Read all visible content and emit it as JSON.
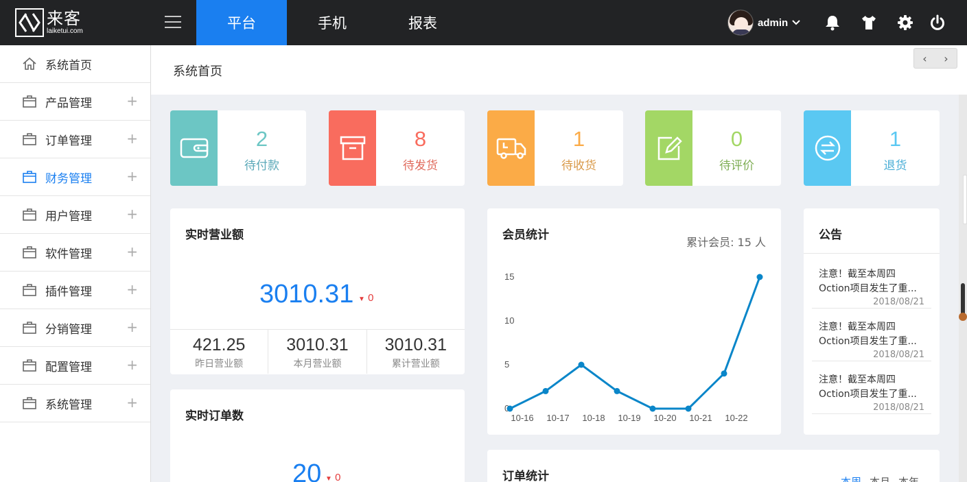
{
  "brand": {
    "name": "来客",
    "domain": "laiketui.com"
  },
  "nav": [
    {
      "label": "平台",
      "active": true
    },
    {
      "label": "手机",
      "active": false
    },
    {
      "label": "报表",
      "active": false
    }
  ],
  "user": {
    "name": "admin"
  },
  "sidebar": {
    "items": [
      {
        "label": "系统首页",
        "icon": "home-icon",
        "expandable": false,
        "active": false
      },
      {
        "label": "产品管理",
        "icon": "briefcase-icon",
        "expandable": true,
        "active": false
      },
      {
        "label": "订单管理",
        "icon": "briefcase-icon",
        "expandable": true,
        "active": false
      },
      {
        "label": "财务管理",
        "icon": "briefcase-icon",
        "expandable": true,
        "active": true
      },
      {
        "label": "用户管理",
        "icon": "briefcase-icon",
        "expandable": true,
        "active": false
      },
      {
        "label": "软件管理",
        "icon": "briefcase-icon",
        "expandable": true,
        "active": false
      },
      {
        "label": "插件管理",
        "icon": "briefcase-icon",
        "expandable": true,
        "active": false
      },
      {
        "label": "分销管理",
        "icon": "briefcase-icon",
        "expandable": true,
        "active": false
      },
      {
        "label": "配置管理",
        "icon": "briefcase-icon",
        "expandable": true,
        "active": false
      },
      {
        "label": "系统管理",
        "icon": "briefcase-icon",
        "expandable": true,
        "active": false
      }
    ],
    "expand_symbol": "+"
  },
  "breadcrumb": "系统首页",
  "pager": {
    "prev": "‹",
    "next": "›"
  },
  "stats": [
    {
      "value": "2",
      "label": "待付款",
      "color": "#6cc6c4",
      "icon": "wallet-icon"
    },
    {
      "value": "8",
      "label": "待发货",
      "color": "#f96c5e",
      "icon": "archive-box-icon"
    },
    {
      "value": "1",
      "label": "待收货",
      "color": "#fbab47",
      "icon": "delivery-truck-icon"
    },
    {
      "value": "0",
      "label": "待评价",
      "color": "#a3d765",
      "icon": "edit-note-icon"
    },
    {
      "value": "1",
      "label": "退货",
      "color": "#5ac8f2",
      "icon": "return-exchange-icon"
    }
  ],
  "revenue": {
    "title": "实时营业额",
    "value": "3010.31",
    "delta": "0",
    "items": [
      {
        "value": "421.25",
        "label": "昨日营业额"
      },
      {
        "value": "3010.31",
        "label": "本月营业额"
      },
      {
        "value": "3010.31",
        "label": "累计营业额"
      }
    ]
  },
  "orders_realtime": {
    "title": "实时订单数",
    "value": "20",
    "delta": "0"
  },
  "members": {
    "title": "会员统计",
    "total_label": "累计会员: 15 人"
  },
  "chart_data": {
    "type": "line",
    "title": "会员统计",
    "categories": [
      "10-16",
      "10-17",
      "10-18",
      "10-19",
      "10-20",
      "10-21",
      "10-22"
    ],
    "x_points": [
      0,
      1,
      2,
      3,
      4,
      5,
      6,
      7
    ],
    "values": [
      0,
      2,
      5,
      2,
      0,
      0,
      4,
      15
    ],
    "yticks": [
      0,
      5,
      10,
      15
    ],
    "ylim": [
      0,
      16
    ],
    "line_color": "#0a86c9",
    "grid": false,
    "legend": "none"
  },
  "notice": {
    "title": "公告",
    "items": [
      {
        "line1": "注意！截至本周四",
        "line2": "Oction项目发生了重...",
        "date": "2018/08/21"
      },
      {
        "line1": "注意！截至本周四",
        "line2": "Oction项目发生了重...",
        "date": "2018/08/21"
      },
      {
        "line1": "注意！截至本周四",
        "line2": "Oction项目发生了重...",
        "date": "2018/08/21"
      }
    ]
  },
  "order_stats": {
    "title": "订单统计",
    "tabs": [
      {
        "label": "本周",
        "active": true
      },
      {
        "label": "本月",
        "active": false
      },
      {
        "label": "本年",
        "active": false
      }
    ]
  }
}
